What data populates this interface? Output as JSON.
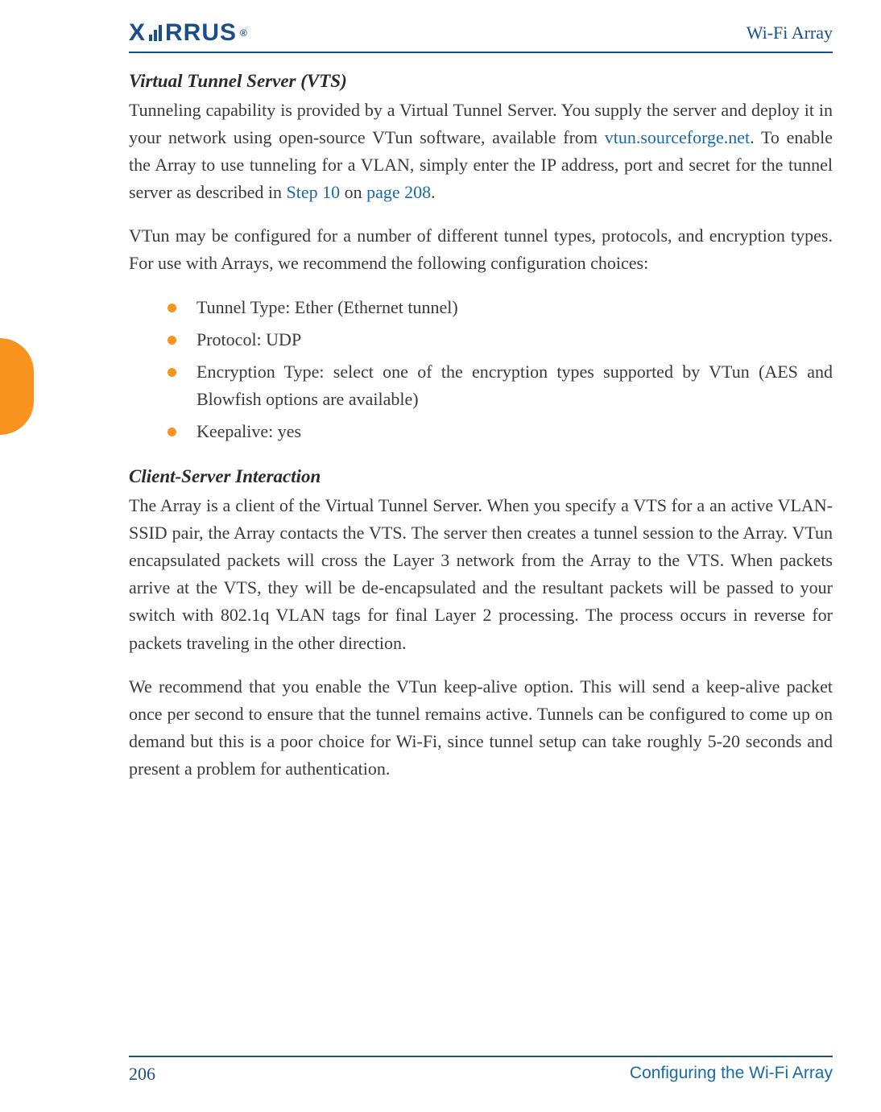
{
  "header": {
    "logo_text_left": "X",
    "logo_text_right": "RRUS",
    "product": "Wi-Fi Array"
  },
  "section1": {
    "title": "Virtual Tunnel Server (VTS)",
    "p1_a": "Tunneling capability is provided by a Virtual Tunnel Server. You supply the server and deploy it in your network using open-source VTun software, available from ",
    "link1": "vtun.sourceforge.net",
    "p1_b": ". To enable the Array to use tunneling for a VLAN, simply enter the IP address, port and secret for the tunnel server as described in ",
    "link2": "Step 10",
    "p1_c": " on ",
    "link3": "page 208",
    "p1_d": ".",
    "p2": "VTun may be configured for a number of different tunnel types, protocols, and encryption types. For use with Arrays, we recommend the following configuration choices:",
    "bullets": [
      "Tunnel Type: Ether (Ethernet tunnel)",
      "Protocol: UDP",
      "Encryption Type: select one of the encryption types supported by VTun (AES and Blowfish options are available)",
      "Keepalive: yes"
    ]
  },
  "section2": {
    "title": "Client-Server Interaction",
    "p1": "The Array is a client of the Virtual Tunnel Server. When you specify a VTS for a an active VLAN-SSID pair, the Array contacts the VTS. The server then creates a tunnel session to the Array. VTun encapsulated packets will cross the Layer 3 network from the Array to the VTS. When packets arrive at the VTS, they will be de-encapsulated and the resultant packets will be passed to your switch with 802.1q VLAN tags for final Layer 2 processing. The process occurs in reverse for packets traveling in the other direction.",
    "p2": "We recommend that you enable the VTun keep-alive option. This will send a keep-alive packet once per second to ensure that the tunnel remains active. Tunnels can be configured to come up on demand but this is a poor choice for Wi-Fi, since tunnel setup can take roughly 5-20 seconds and present a problem for authentication."
  },
  "footer": {
    "page": "206",
    "section": "Configuring the Wi-Fi Array"
  }
}
